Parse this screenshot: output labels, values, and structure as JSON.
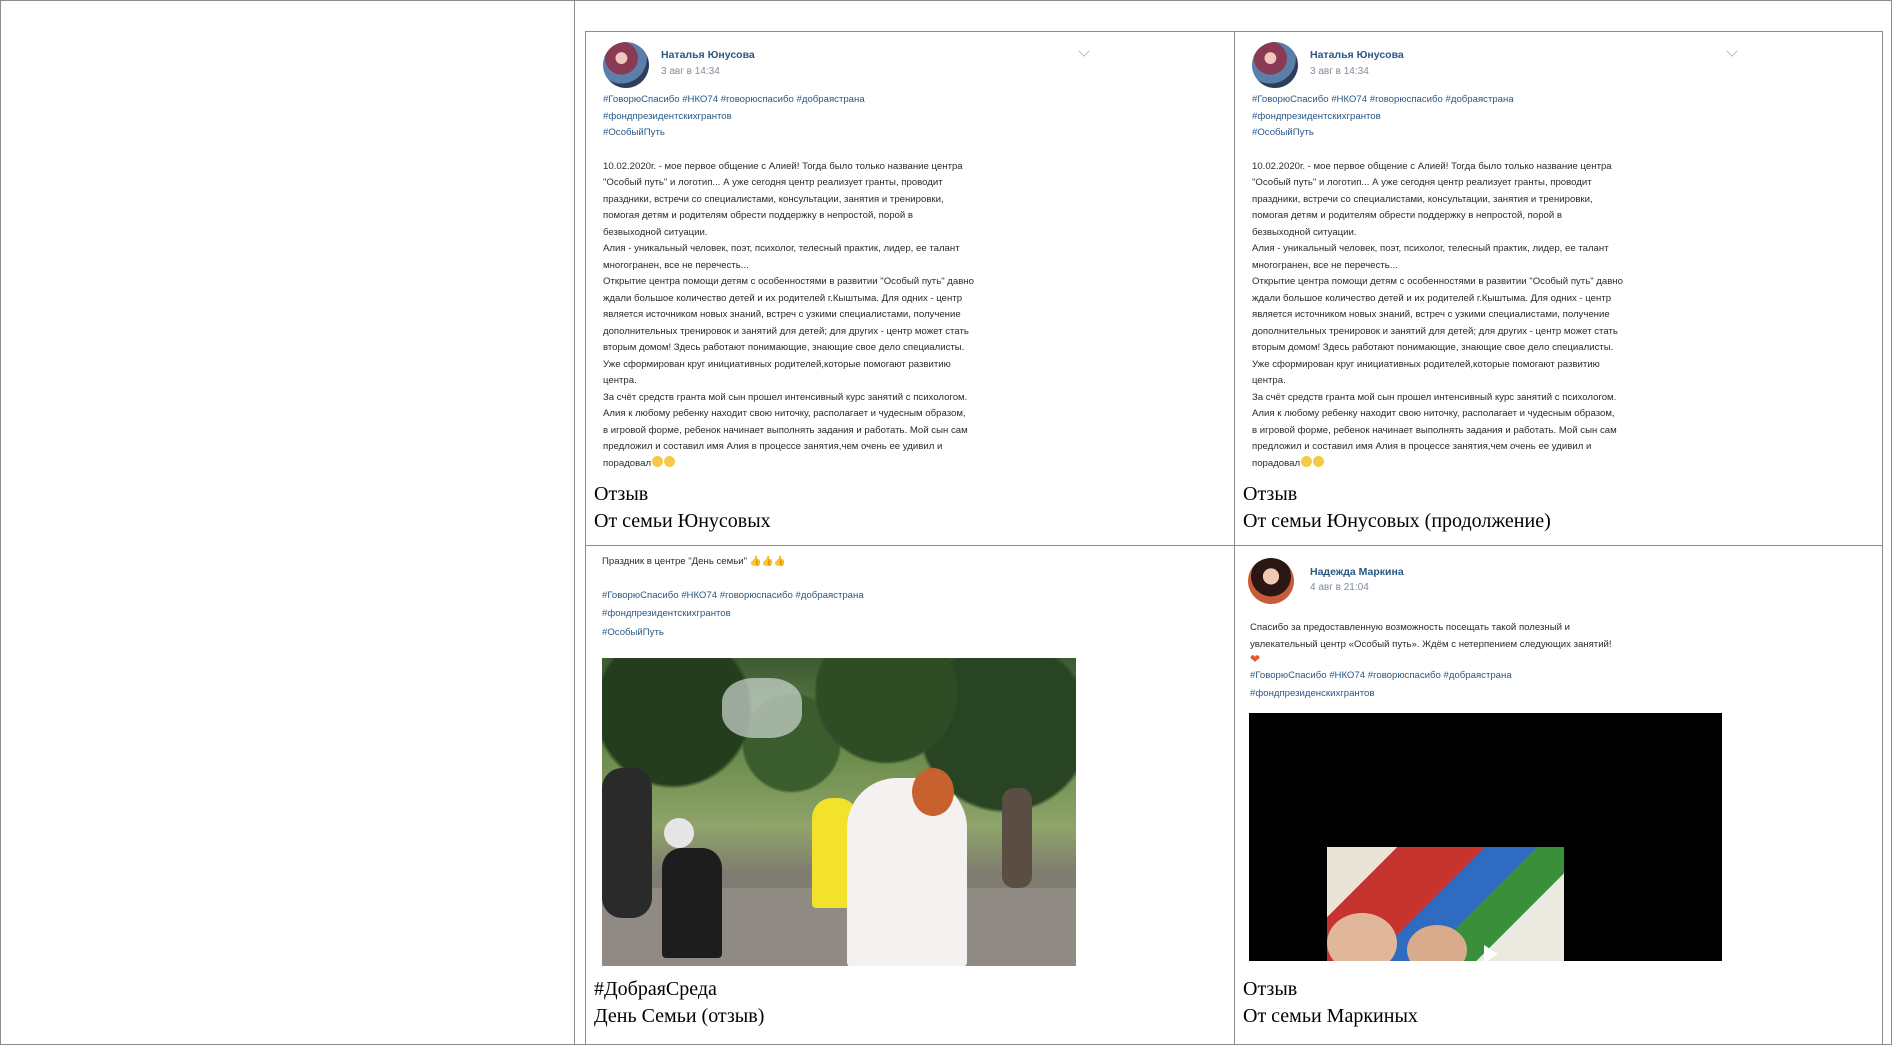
{
  "cells": [
    {
      "post": {
        "author": "Наталья Юнусова",
        "date": "3 авг в 14:34",
        "tags": "#ГоворюСпасибо #НКО74 #говорюспасибо #добраястрана\n#фондпрезидентскихгрантов\n#ОсобыйПуть",
        "text": "10.02.2020г. - мое первое общение с Алией! Тогда было только название центра\n\"Особый путь\" и логотип... А уже сегодня центр реализует гранты, проводит\nпраздники, встречи со специалистами, консультации, занятия и тренировки,\nпомогая детям и родителям обрести поддержку в непростой, порой в\nбезвыходной ситуации.\nАлия - уникальный человек, поэт, психолог, телесный практик, лидер, ее талант\nмногогранен, все не перечесть...\nОткрытие центра помощи детям с особенностями в развитии \"Особый путь\" давно\nждали большое количество детей и их родителей г.Кыштыма. Для одних - центр\nявляется источником новых знаний, встреч с узкими специалистами, получение\nдополнительных тренировок и занятий для детей; для других - центр может стать\nвторым домом! Здесь работают понимающие, знающие свое дело специалисты.\nУже сформирован круг инициативных родителей,которые помогают развитию\nцентра.\nЗа счёт средств гранта мой сын прошел интенсивный курс занятий с психологом.\nАлия к любому ребенку находит свою ниточку, располагает и чудесным образом,\nв игровой форме, ребенок начинает выполнять задания и работать. Мой сын сам\nпредложил и составил имя Алия в процессе занятия,чем очень ее удивил и\nпорадовал"
      },
      "caption_line1": "Отзыв",
      "caption_line2": "От семьи Юнусовых"
    },
    {
      "post": {
        "author": "Наталья Юнусова",
        "date": "3 авг в 14:34",
        "tags": "#ГоворюСпасибо #НКО74 #говорюспасибо #добраястрана\n#фондпрезидентскихгрантов\n#ОсобыйПуть",
        "text": "10.02.2020г. - мое первое общение с Алией! Тогда было только название центра\n\"Особый путь\" и логотип... А уже сегодня центр реализует гранты, проводит\nпраздники, встречи со специалистами, консультации, занятия и тренировки,\nпомогая детям и родителям обрести поддержку в непростой, порой в\nбезвыходной ситуации.\nАлия - уникальный человек, поэт, психолог, телесный практик, лидер, ее талант\nмногогранен, все не перечесть...\nОткрытие центра помощи детям с особенностями в развитии \"Особый путь\" давно\nждали большое количество детей и их родителей г.Кыштыма. Для одних - центр\nявляется источником новых знаний, встреч с узкими специалистами, получение\nдополнительных тренировок и занятий для детей; для других - центр может стать\nвторым домом! Здесь работают понимающие, знающие свое дело специалисты.\nУже сформирован круг инициативных родителей,которые помогают развитию\nцентра.\nЗа счёт средств гранта мой сын прошел интенсивный курс занятий с психологом.\nАлия к любому ребенку находит свою ниточку, располагает и чудесным образом,\nв игровой форме, ребенок начинает выполнять задания и работать. Мой сын сам\nпредложил и составил имя Алия в процессе занятия,чем очень ее удивил и\nпорадовал"
      },
      "caption_line1": "Отзыв",
      "caption_line2": "От семьи Юнусовых (продолжение)"
    },
    {
      "post": {
        "text": "Праздник в центре \"День семьи\"",
        "tags": "#ГоворюСпасибо #НКО74 #говорюспасибо #добраястрана\n#фондпрезидентскихгрантов\n#ОсобыйПуть"
      },
      "caption_line1": "#ДобраяСреда",
      "caption_line2": "День Семьи (отзыв)"
    },
    {
      "post": {
        "author": "Надежда Маркина",
        "date": "4 авг в 21:04",
        "text": "Спасибо за предоставленную возможность посещать такой полезный и\nувлекательный центр «Особый путь». Ждём с нетерпением следующих занятий!",
        "tags": "#ГоворюСпасибо #НКО74 #говорюспасибо #добраястрана\n#фондпрезиденскихгрантов"
      },
      "caption_line1": "Отзыв",
      "caption_line2": "От семьи Маркиных"
    }
  ]
}
